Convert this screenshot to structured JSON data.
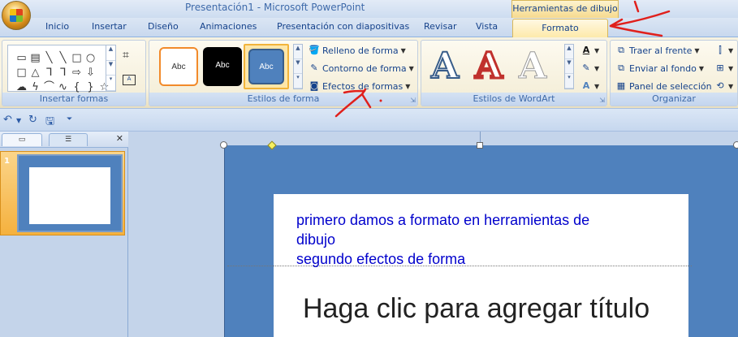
{
  "window": {
    "title": "Presentación1 - Microsoft PowerPoint",
    "context_tab_label": "Herramientas de dibujo"
  },
  "tabs": [
    "Inicio",
    "Insertar",
    "Diseño",
    "Animaciones",
    "Presentación con diapositivas",
    "Revisar",
    "Vista",
    "Formato"
  ],
  "ribbon": {
    "groups": {
      "insert_shapes": "Insertar formas",
      "shape_styles": "Estilos de forma",
      "wordart_styles": "Estilos de WordArt",
      "arrange": "Organizar"
    },
    "style_samples": [
      "Abc",
      "Abc",
      "Abc"
    ],
    "shape_commands": {
      "fill": "Relleno de forma",
      "outline": "Contorno de forma",
      "effects": "Efectos de formas"
    },
    "wordart_samples": [
      "A",
      "A",
      "A"
    ],
    "arrange_commands": {
      "bring_front": "Traer al frente",
      "send_back": "Enviar al fondo",
      "selection_pane": "Panel de selección"
    }
  },
  "slides_panel": {
    "slide_number": "1"
  },
  "slide": {
    "note_lines": [
      "primero damos a formato en herramientas de",
      "dibujo",
      "segundo efectos de forma"
    ],
    "placeholder_text": "Haga clic para agregar título"
  },
  "colors": {
    "accent_red": "#e0201c",
    "slide_blue": "#4f81bd",
    "note_blue": "#0000cc"
  }
}
